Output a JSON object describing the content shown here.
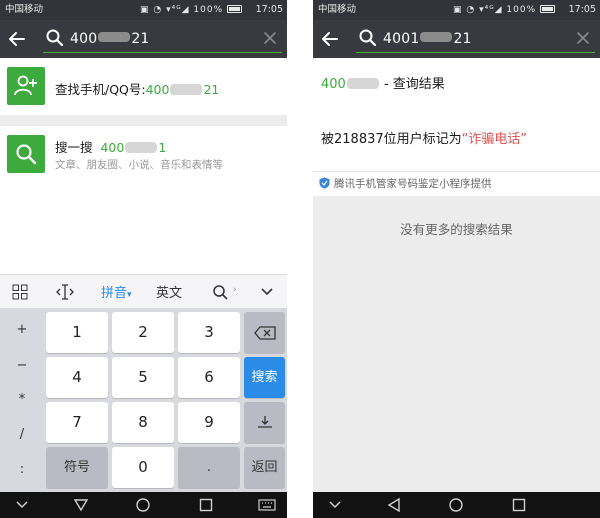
{
  "status": {
    "carrier": "中国移动",
    "signal_icons": "▣ ◔ ▾⁴ᴳ◢",
    "battery": "100%",
    "time": "17:05"
  },
  "left": {
    "search_query_pre": "400",
    "search_query_post": "21",
    "find_row": {
      "label": "查找手机/QQ号:",
      "number_pre": "400",
      "number_post": "21"
    },
    "sousou_row": {
      "label": "搜一搜",
      "number_pre": "400",
      "number_post": "1",
      "subtitle": "文章、朋友圈、小说、音乐和表情等"
    },
    "keyboard": {
      "toolbar": {
        "pinyin": "拼音",
        "english": "英文"
      },
      "symbols": [
        "+",
        "−",
        "*",
        "/",
        ":"
      ],
      "keys": [
        "1",
        "2",
        "3",
        "4",
        "5",
        "6",
        "7",
        "8",
        "9",
        "0",
        "."
      ],
      "symbol_key": "符号",
      "search_key": "搜索",
      "return_key": "返回"
    }
  },
  "right": {
    "search_query_pre": "4001",
    "search_query_post": "21",
    "title_number_pre": "400",
    "title_suffix": "- 查询结果",
    "mark_text": "被218837位用户标记为",
    "mark_quote_open": "“",
    "mark_label": "诈骗电话",
    "mark_quote_close": "”",
    "provider": "腾讯手机管家号码鉴定小程序提供",
    "no_more": "没有更多的搜索结果"
  },
  "colors": {
    "accent_green": "#3caa3c",
    "alert_red": "#e25050",
    "key_blue": "#2b8ce8",
    "header_dark": "#393a3f"
  }
}
